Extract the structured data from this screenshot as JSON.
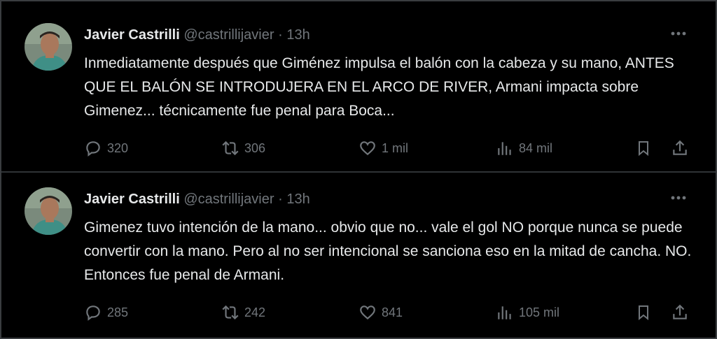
{
  "colors": {
    "background": "#000000",
    "text": "#e7e9ea",
    "secondary": "#71767b",
    "border": "#2f3336"
  },
  "tweets": [
    {
      "author": {
        "name": "Javier Castrilli",
        "handle": "@castrillijavier",
        "avatar": "avatar-photo"
      },
      "separator": "·",
      "time": "13h",
      "text": "Inmediatamente después que Giménez impulsa el balón con la cabeza y su mano, ANTES QUE EL BALÓN SE INTRODUJERA EN EL ARCO DE RIVER, Armani impacta sobre Gimenez... técnicamente fue penal para Boca...",
      "stats": {
        "replies": "320",
        "retweets": "306",
        "likes": "1 mil",
        "views": "84 mil"
      }
    },
    {
      "author": {
        "name": "Javier Castrilli",
        "handle": "@castrillijavier",
        "avatar": "avatar-photo"
      },
      "separator": "·",
      "time": "13h",
      "text": "Gimenez tuvo intención de la mano... obvio que no... vale el gol NO porque nunca se puede convertir con la mano. Pero al no ser intencional se sanciona eso en la mitad de cancha. NO. Entonces fue penal de Armani.",
      "stats": {
        "replies": "285",
        "retweets": "242",
        "likes": "841",
        "views": "105 mil"
      }
    }
  ],
  "icons": {
    "reply": "reply-icon",
    "retweet": "retweet-icon",
    "like": "like-icon",
    "views": "views-icon",
    "bookmark": "bookmark-icon",
    "share": "share-icon",
    "more": "more-icon"
  }
}
